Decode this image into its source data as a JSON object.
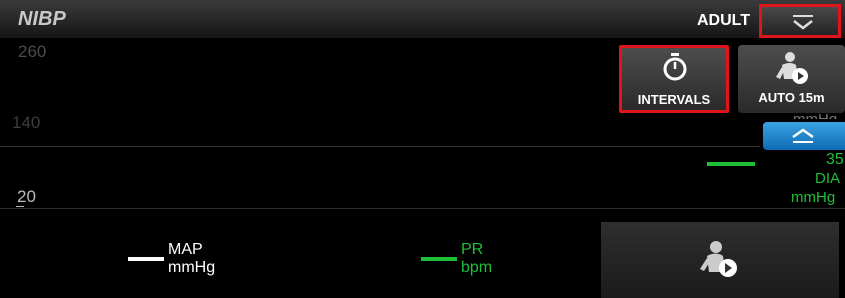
{
  "header": {
    "title": "NIBP",
    "mode": "ADULT"
  },
  "scale": {
    "top": "260",
    "mid": "140",
    "bottom": "20"
  },
  "buttons": {
    "intervals": "INTERVALS",
    "auto": "AUTO 15m"
  },
  "partial_unit": "mmHg",
  "dia": {
    "value": "35",
    "label": "DIA",
    "unit": "mmHg"
  },
  "legend": {
    "map": {
      "label": "MAP",
      "unit": "mmHg"
    },
    "pr": {
      "label": "PR",
      "unit": "bpm"
    }
  },
  "colors": {
    "highlight": "#e0141a",
    "green": "#1fbf3a",
    "blue": "#1a86d0"
  },
  "icons": [
    "chevron-down-icon",
    "stopwatch-icon",
    "person-play-icon",
    "chevron-up-icon"
  ]
}
